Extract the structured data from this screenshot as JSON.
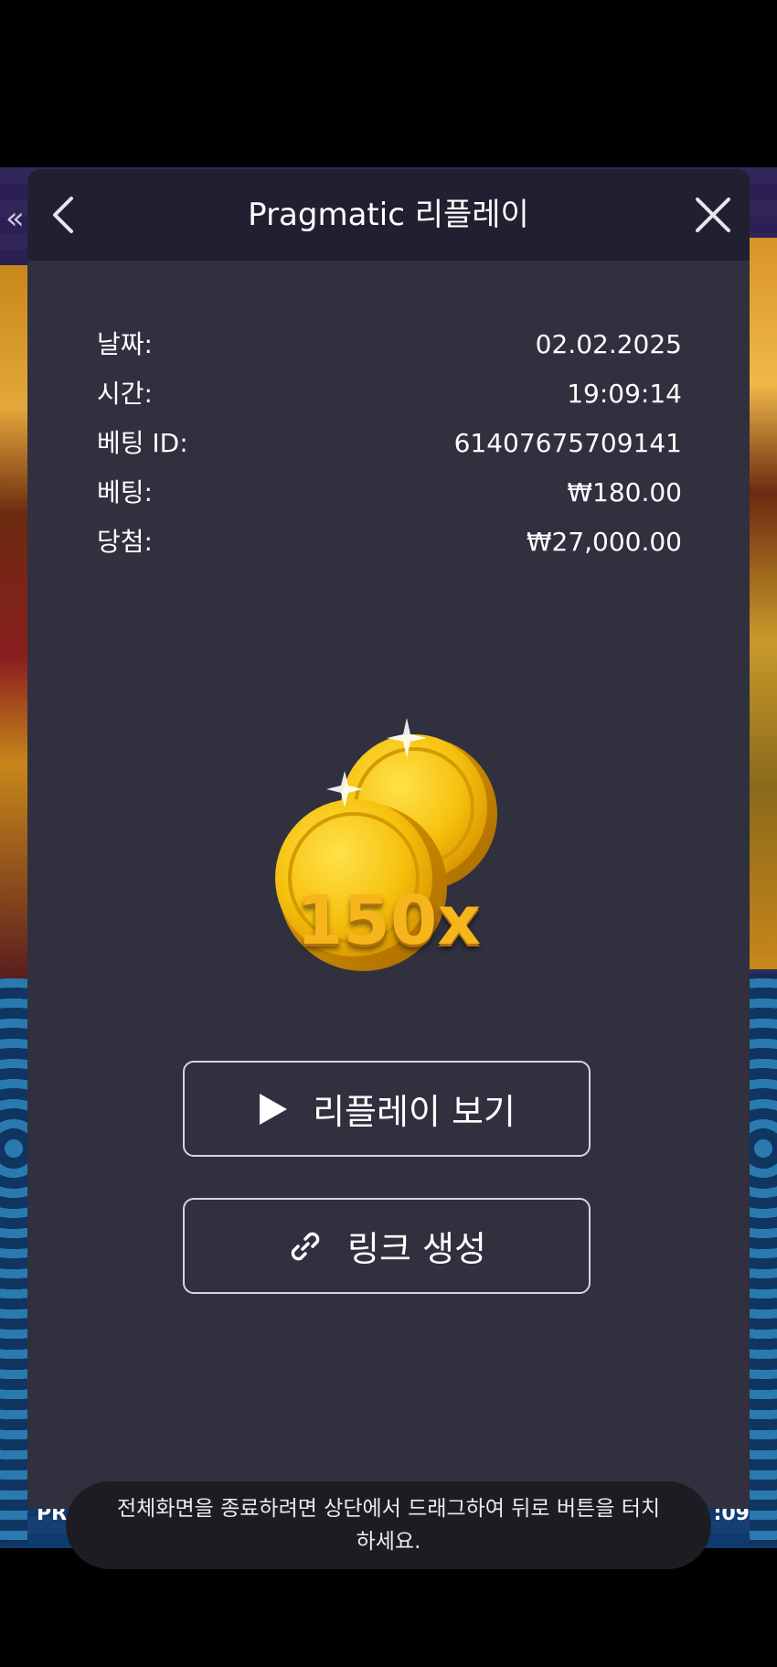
{
  "background": {
    "left_chevron": "«",
    "bottom_left_text": "PR",
    "bottom_right_text": ":09"
  },
  "dialog": {
    "title": "Pragmatic 리플레이",
    "back_icon": "chevron-left-icon",
    "close_icon": "close-icon"
  },
  "details": [
    {
      "label": "날짜:",
      "value": "02.02.2025"
    },
    {
      "label": "시간:",
      "value": "19:09:14"
    },
    {
      "label": "베팅 ID:",
      "value": "61407675709141"
    },
    {
      "label": "베팅:",
      "value": "₩180.00"
    },
    {
      "label": "당첨:",
      "value": "₩27,000.00"
    }
  ],
  "win": {
    "multiplier": "150x",
    "icon": "gold-coins-icon"
  },
  "buttons": {
    "replay_label": "리플레이 보기",
    "replay_icon": "play-icon",
    "link_label": "링크 생성",
    "link_icon": "link-icon"
  },
  "toast": {
    "text": "전체화면을 종료하려면 상단에서 드래그하여 뒤로 버튼을 터치하세요."
  },
  "colors": {
    "dialog_bg": "#30303f",
    "header_bg": "#202030",
    "multiplier": "#f7b51c"
  }
}
